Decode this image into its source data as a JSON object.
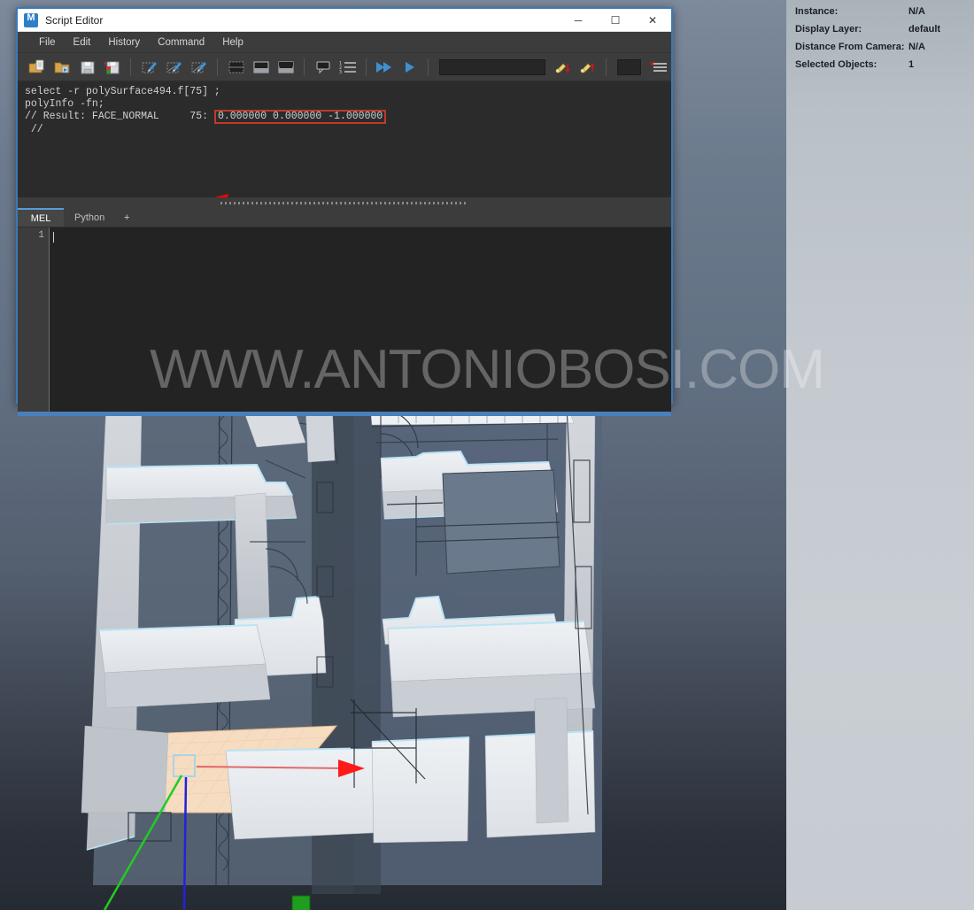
{
  "window": {
    "title": "Script Editor",
    "app_icon": "maya-m-icon",
    "controls": {
      "minimize": "─",
      "maximize": "☐",
      "close": "✕"
    }
  },
  "menu": {
    "items": [
      "File",
      "Edit",
      "History",
      "Command",
      "Help"
    ]
  },
  "toolbar": {
    "buttons": [
      {
        "name": "new-script-icon",
        "glyph": "📂"
      },
      {
        "name": "open-script-icon",
        "glyph": "📁"
      },
      {
        "name": "save-script-icon",
        "glyph": "💾"
      },
      {
        "name": "save-script-as-icon",
        "glyph": "💾"
      },
      {
        "name": "clear-history-icon",
        "glyph": "✐"
      },
      {
        "name": "clear-input-icon",
        "glyph": "✐"
      },
      {
        "name": "clear-all-icon",
        "glyph": "✐"
      },
      {
        "name": "layout-single-icon",
        "glyph": "▭"
      },
      {
        "name": "layout-split-horizontal-icon",
        "glyph": "▭"
      },
      {
        "name": "layout-split-vertical-icon",
        "glyph": "▭"
      },
      {
        "name": "show-tooltip-icon",
        "glyph": "▭"
      },
      {
        "name": "line-numbers-icon",
        "glyph": "☰"
      },
      {
        "name": "execute-all-icon",
        "glyph": "▶▶"
      },
      {
        "name": "execute-selection-icon",
        "glyph": "▶"
      }
    ],
    "search_value": "",
    "search_placeholder": "",
    "extra_buttons": [
      {
        "name": "search-down-icon",
        "glyph": "▾"
      },
      {
        "name": "search-up-icon",
        "glyph": "▴"
      }
    ],
    "color_swatch": "#262626",
    "options_icon": "options-menu-icon"
  },
  "output": {
    "lines": [
      {
        "id": "line1",
        "text": "select -r polySurface494.f[75] ;",
        "highlight": false
      },
      {
        "id": "line2",
        "text": "polyInfo -fn;",
        "highlight": false
      }
    ],
    "result_prefix": "// Result: FACE_NORMAL     75: ",
    "result_value": "0.000000 0.000000 -1.000000",
    "result_suffix": " //",
    "highlight_color": "#c0392b"
  },
  "annotation": {
    "arrow_color": "#ff0000",
    "arrow_name": "red-annotation-arrow"
  },
  "tabs": {
    "items": [
      {
        "label": "MEL",
        "active": true
      },
      {
        "label": "Python",
        "active": false
      },
      {
        "label": "+",
        "active": false
      }
    ]
  },
  "editor": {
    "line_numbers": [
      "1"
    ],
    "content": ""
  },
  "status": {
    "rows": [
      {
        "label": "Instance:",
        "value": "N/A"
      },
      {
        "label": "Display Layer:",
        "value": "default"
      },
      {
        "label": "Distance From Camera:",
        "value": "N/A"
      },
      {
        "label": "Selected Objects:",
        "value": "1"
      }
    ]
  },
  "viewport": {
    "name": "maya-3d-viewport",
    "selected_face_color": "#f5d8bd",
    "manipulator_axis_x_color": "#ff2a2a",
    "manipulator_axis_y_color": "#2020dd",
    "manipulator_axis_z_color": "#18c018",
    "wall_fill": "#c6cad0",
    "floor_fill": "#e8ecef",
    "edge_highlight": "#b9e4f5",
    "background_top": "#7d8a9c",
    "background_bottom": "#262b33"
  },
  "watermark": {
    "text": "WWW.ANTONIOBOSI.COM"
  }
}
